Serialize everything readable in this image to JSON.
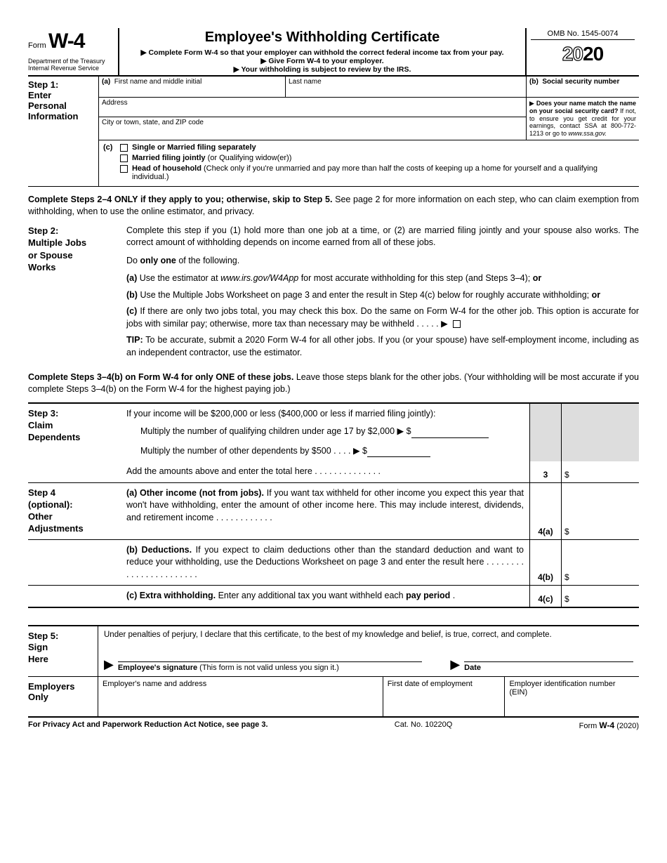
{
  "header": {
    "form_prefix": "Form",
    "form_number": "W-4",
    "dept1": "Department of the Treasury",
    "dept2": "Internal Revenue Service",
    "title": "Employee's Withholding Certificate",
    "line1": "▶ Complete Form W-4 so that your employer can withhold the correct federal income tax from your pay.",
    "line2": "▶ Give Form W-4 to your employer.",
    "line3": "▶ Your withholding is subject to review by the IRS.",
    "omb": "OMB No. 1545-0074",
    "year_outline": "20",
    "year_solid": "20"
  },
  "step1": {
    "heading_line1": "Step 1:",
    "heading_line2": "Enter",
    "heading_line3": "Personal",
    "heading_line4": "Information",
    "a_label": "(a)",
    "first_name_label": "First name and middle initial",
    "last_name_label": "Last name",
    "b_label": "(b)",
    "ssn_label": "Social security number",
    "address_label": "Address",
    "city_label": "City or town, state, and ZIP code",
    "ssn_note_pre": "▶ ",
    "ssn_note_bold": "Does your name match the name on your social security card?",
    "ssn_note_rest": " If not, to ensure you get credit for your earnings, contact SSA at 800-772-1213 or go to ",
    "ssn_note_url": "www.ssa.gov.",
    "c_label": "(c)",
    "c_opt1": "Single or Married filing separately",
    "c_opt2a": "Married filing jointly",
    "c_opt2b": " (or Qualifying widow(er))",
    "c_opt3a": "Head of household",
    "c_opt3b": " (Check only if you're unmarried and pay more than half the costs of keeping up a home for yourself and a qualifying individual.)"
  },
  "para24": {
    "bold": "Complete Steps 2–4 ONLY if they apply to you; otherwise, skip to Step 5.",
    "rest": " See page 2 for more information on each step, who can claim exemption from withholding, when to use the online estimator, and privacy."
  },
  "step2": {
    "heading_l1": "Step 2:",
    "heading_l2": "Multiple Jobs",
    "heading_l3": "or Spouse",
    "heading_l4": "Works",
    "intro": "Complete this step if you (1) hold more than one job at a time, or (2) are married filing jointly and your spouse also works. The correct amount of withholding depends on income earned from all of these jobs.",
    "do_prefix": "Do ",
    "do_bold": "only one",
    "do_suffix": " of the following.",
    "a_pre": "(a) ",
    "a_txt1": "Use the estimator at ",
    "a_url": "www.irs.gov/W4App",
    "a_txt2": " for most accurate withholding for this step (and Steps 3–4); ",
    "a_or": "or",
    "b_pre": "(b) ",
    "b_txt": "Use the Multiple Jobs Worksheet on page 3 and enter the result in Step 4(c) below for roughly accurate withholding; ",
    "b_or": "or",
    "c_pre": "(c) ",
    "c_txt": "If there are only two jobs total, you may check this box. Do the same on Form W-4 for the other job. This option is accurate for jobs with similar pay; otherwise, more tax than necessary may be withheld   .    .    .    .    .   ▶",
    "tip_bold": "TIP:",
    "tip_txt": " To be accurate, submit a 2020 Form W-4 for all other jobs. If you (or your spouse) have self-employment income, including as an independent contractor, use the estimator."
  },
  "para34": {
    "bold": "Complete Steps 3–4(b) on Form W-4 for only ONE of these jobs.",
    "rest": " Leave those steps blank for the other jobs. (Your withholding will be most accurate if you complete Steps 3–4(b) on the Form W-4 for the highest paying job.)"
  },
  "step3": {
    "heading_l1": "Step 3:",
    "heading_l2": "Claim",
    "heading_l3": "Dependents",
    "intro": "If your income will be $200,000 or less ($400,000 or less if married filing jointly):",
    "line1": "Multiply the number of qualifying children under age 17 by $2,000 ▶ $",
    "line2": "Multiply the number of other dependents by $500    .    .    .    . ▶ $",
    "total_txt": "Add the amounts above and enter the total here    .    .    .    .    .    .    .    .    .    .    .    .    .    .",
    "total_num": "3",
    "total_dollar": "$"
  },
  "step4": {
    "heading_l1": "Step 4",
    "heading_l2": "(optional):",
    "heading_l3": "Other",
    "heading_l4": "Adjustments",
    "a_bold": "(a) Other income (not from jobs).",
    "a_txt": " If you want tax withheld for other income you expect this year that won't have withholding, enter the amount of other income here. This may include interest, dividends, and retirement income    .    .    .    .    .    .    .    .    .    .    .    .",
    "a_num": "4(a)",
    "b_bold": "(b) Deductions.",
    "b_txt": " If you expect to claim deductions other than the standard deduction and want to reduce your withholding, use the Deductions Worksheet on page 3 and enter the result here   .   .   .   .   .   .   .   .   .   .   .   .   .   .   .   .   .   .   .   .   .   .   .",
    "b_num": "4(b)",
    "c_bold": "(c) Extra withholding.",
    "c_txt1": " Enter any additional tax you want withheld each ",
    "c_bold2": "pay period",
    "c_txt2": "    .",
    "c_num": "4(c)",
    "dollar": "$"
  },
  "step5": {
    "heading_l1": "Step 5:",
    "heading_l2": "Sign",
    "heading_l3": "Here",
    "perjury": "Under penalties of perjury, I declare that this certificate, to the best of my knowledge and belief, is true, correct, and complete.",
    "sig_bold": "Employee's signature",
    "sig_note": " (This form is not valid unless you sign it.)",
    "date_label": "Date",
    "arrow": "▶"
  },
  "employers": {
    "heading_l1": "Employers",
    "heading_l2": "Only",
    "name_label": "Employer's name and address",
    "date_label": "First date of employment",
    "ein_label": "Employer identification number (EIN)"
  },
  "footer": {
    "left": "For Privacy Act and Paperwork Reduction Act Notice, see page 3.",
    "center": "Cat. No. 10220Q",
    "right_pre": "Form ",
    "right_form": "W-4",
    "right_suffix": " (2020)"
  }
}
